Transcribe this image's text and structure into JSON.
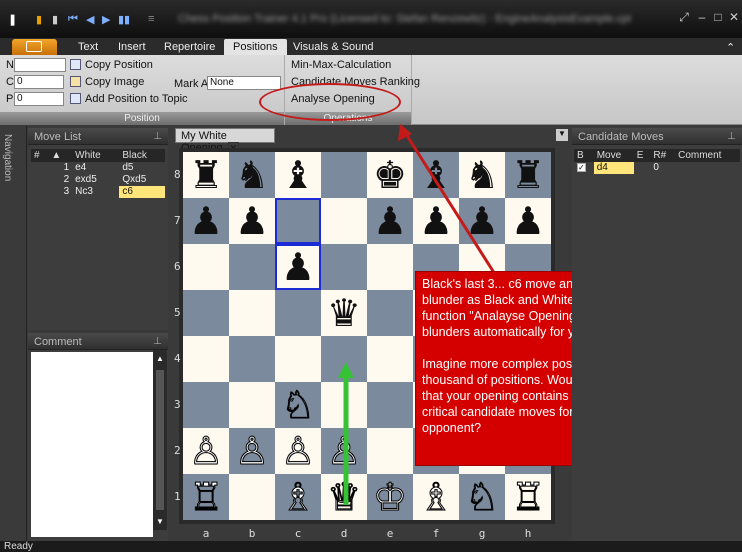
{
  "window": {
    "title": "Chess Position Trainer 4.1 Pro (Licensed to: Stefan Renzewitz) - EngineAnalysisExample.cpt"
  },
  "ribbon": {
    "tabs": [
      "Text",
      "Insert",
      "Repertoire",
      "Positions",
      "Visuals & Sound"
    ],
    "active_tab": "Positions",
    "position": {
      "n_label": "N",
      "c_label": "C",
      "p_label": "P",
      "c_value": "0",
      "p_value": "0",
      "copy_position": "Copy Position",
      "copy_image": "Copy Image",
      "add_to_topic": "Add Position to Topic",
      "mark_as_label": "Mark As",
      "mark_as_value": "None",
      "group_label": "Position"
    },
    "operations": {
      "items": [
        "Min-Max-Calculation",
        "Candidate Moves Ranking",
        "Analyse Opening"
      ],
      "group_label": "Operations"
    }
  },
  "navigation": {
    "label": "Navigation"
  },
  "move_list": {
    "title": "Move List",
    "headers": [
      "#",
      "▲",
      "White",
      "Black"
    ],
    "rows": [
      [
        "1",
        "e4",
        "d5"
      ],
      [
        "2",
        "exd5",
        "Qxd5"
      ],
      [
        "3",
        "Nc3",
        "c6"
      ]
    ]
  },
  "comment": {
    "title": "Comment"
  },
  "document": {
    "tab_title": "My White Opening"
  },
  "board": {
    "ranks": [
      "8",
      "7",
      "6",
      "5",
      "4",
      "3",
      "2",
      "1"
    ],
    "files": [
      "a",
      "b",
      "c",
      "d",
      "e",
      "f",
      "g",
      "h"
    ],
    "squares": [
      [
        "♜",
        "♞",
        "♝",
        "",
        "♚",
        "♝",
        "♞",
        "♜"
      ],
      [
        "♟",
        "♟",
        "",
        "",
        "♟",
        "♟",
        "♟",
        "♟"
      ],
      [
        "",
        "",
        "♟",
        "",
        "",
        "",
        "",
        ""
      ],
      [
        "",
        "",
        "",
        "♛",
        "",
        "",
        "",
        ""
      ],
      [
        "",
        "",
        "",
        "",
        "",
        "",
        "",
        ""
      ],
      [
        "",
        "",
        "♘",
        "",
        "",
        "",
        "",
        ""
      ],
      [
        "♙",
        "♙",
        "♙",
        "♙",
        "",
        "♙",
        "♙",
        "♙"
      ],
      [
        "♖",
        "",
        "♗",
        "♕",
        "♔",
        "♗",
        "♘",
        "♖"
      ]
    ],
    "colors": [
      [
        "b",
        "b",
        "b",
        "",
        "b",
        "b",
        "b",
        "b"
      ],
      [
        "b",
        "b",
        "",
        "",
        "b",
        "b",
        "b",
        "b"
      ],
      [
        "",
        "",
        "b",
        "",
        "",
        "",
        "",
        ""
      ],
      [
        "",
        "",
        "",
        "b",
        "",
        "",
        "",
        ""
      ],
      [
        "",
        "",
        "",
        "",
        "",
        "",
        "",
        ""
      ],
      [
        "",
        "",
        "w",
        "",
        "",
        "",
        "",
        ""
      ],
      [
        "w",
        "w",
        "w",
        "w",
        "",
        "w",
        "w",
        "w"
      ],
      [
        "w",
        "",
        "w",
        "w",
        "w",
        "w",
        "w",
        "w"
      ]
    ],
    "highlight": [
      "c7",
      "c6"
    ],
    "arrow": {
      "from": "d2",
      "to": "d4",
      "color": "#35c235"
    }
  },
  "candidate_moves": {
    "title": "Candidate Moves",
    "headers": [
      "B",
      "Move",
      "E",
      "R#",
      "Comment"
    ],
    "rows": [
      {
        "move": "d4",
        "rank": "0"
      }
    ]
  },
  "callout": {
    "p1": "Black's last 3... c6 move and now White's 4. d4 are a blunder as Black and White have better options. The function \"Analayse Opening\" will detect these blunders automatically for you as you will see.",
    "p2": "Imagine more complex positions and openings with thousand of positions. Wouldn't it be great to know that your opening contains no blunders / missing critical candidate moves for your side or your opponent?"
  },
  "status": {
    "text": "Ready"
  }
}
